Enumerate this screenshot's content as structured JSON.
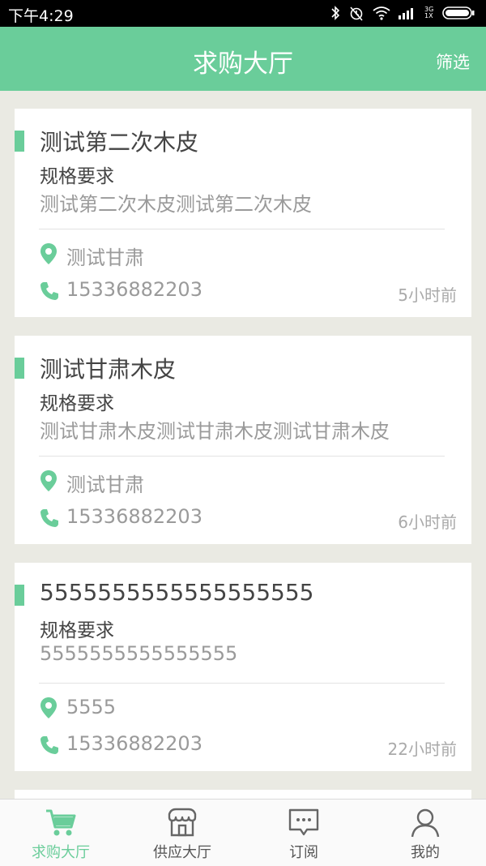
{
  "status_bar": {
    "time": "下午4:29",
    "network": "3G 1X"
  },
  "header": {
    "title": "求购大厅",
    "filter_label": "筛选"
  },
  "listings": [
    {
      "title": "测试第二次木皮",
      "spec_label": "规格要求",
      "spec_text": "测试第二次木皮测试第二次木皮",
      "location": "测试甘肃",
      "phone": "15336882203",
      "time_ago": "5小时前"
    },
    {
      "title": "测试甘肃木皮",
      "spec_label": "规格要求",
      "spec_text": "测试甘肃木皮测试甘肃木皮测试甘肃木皮",
      "location": "测试甘肃",
      "phone": "15336882203",
      "time_ago": "6小时前"
    },
    {
      "title": "5555555555555555555",
      "spec_label": "规格要求",
      "spec_text": "5555555555555555",
      "location": "5555",
      "phone": "15336882203",
      "time_ago": "22小时前"
    }
  ],
  "tabs": [
    {
      "label": "求购大厅",
      "icon": "cart-icon",
      "active": true
    },
    {
      "label": "供应大厅",
      "icon": "store-icon",
      "active": false
    },
    {
      "label": "订阅",
      "icon": "message-icon",
      "active": false
    },
    {
      "label": "我的",
      "icon": "person-icon",
      "active": false
    }
  ],
  "colors": {
    "accent": "#6acd9a",
    "background": "#eaeae3"
  }
}
